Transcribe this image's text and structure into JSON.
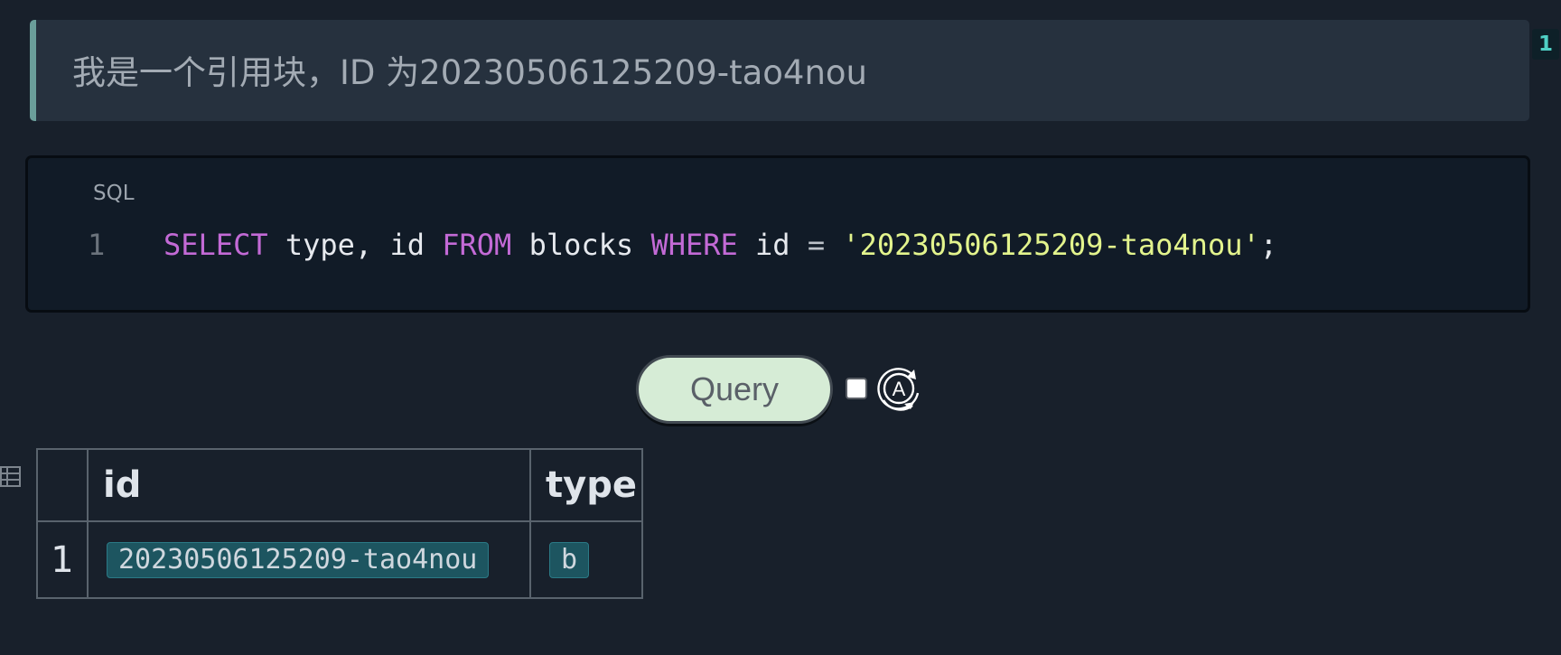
{
  "blockquote": {
    "text": "我是一个引用块，ID 为20230506125209-tao4nou",
    "ref_count": "1"
  },
  "code_block": {
    "language": "SQL",
    "line_number": "1",
    "tokens": {
      "select": "SELECT",
      "fields": " type, id ",
      "from": "FROM",
      "table": " blocks ",
      "where": "WHERE",
      "column": " id ",
      "operator": "=",
      "space": " ",
      "value": "'20230506125209-tao4nou'",
      "end": ";"
    }
  },
  "query_controls": {
    "button_label": "Query",
    "auto_refresh_checked": false,
    "auto_refresh_icon": "auto-refresh-icon"
  },
  "results": {
    "icon": "table-icon",
    "columns": [
      "",
      "id",
      "type"
    ],
    "rows": [
      {
        "index": "1",
        "id": "20230506125209-tao4nou",
        "type": "b"
      }
    ]
  },
  "colors": {
    "background": "#18202b",
    "blockquote_bg": "#26313e",
    "blockquote_border": "#6a9e9a",
    "keyword": "#c36ad6",
    "string": "#e3f48d",
    "button_bg": "#d6ecd6",
    "chip_bg": "#1d5560"
  }
}
